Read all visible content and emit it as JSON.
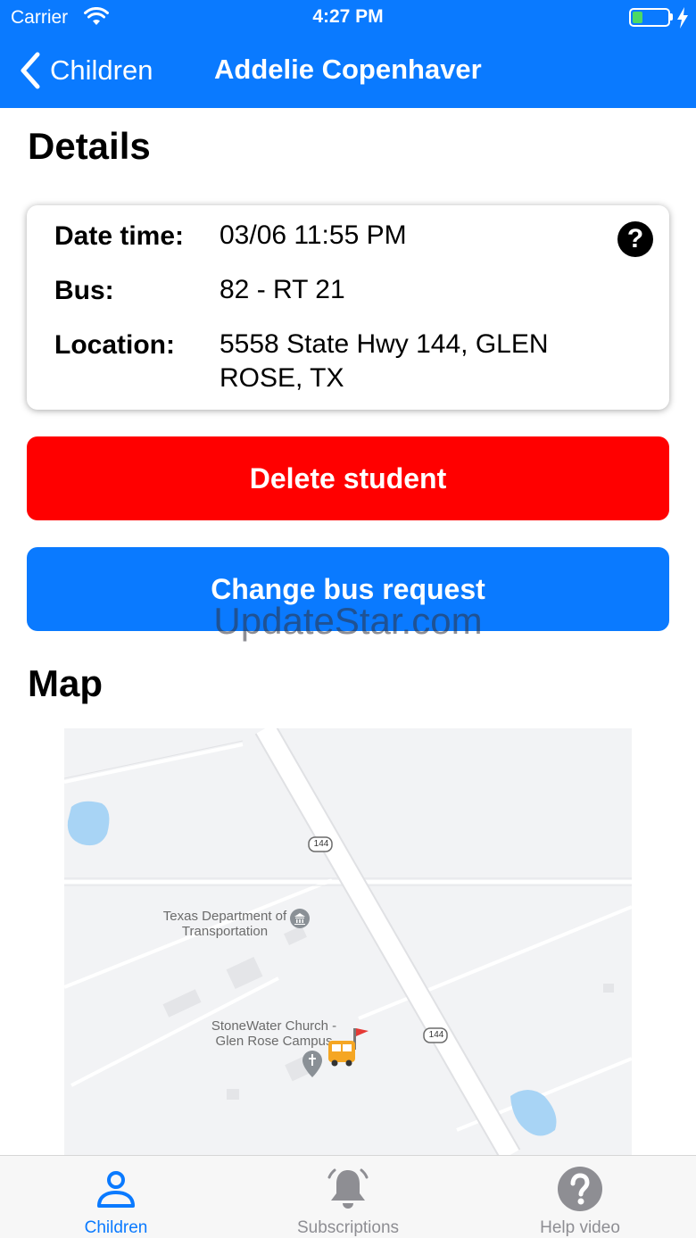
{
  "status_bar": {
    "carrier": "Carrier",
    "time": "4:27 PM",
    "battery_level": 0.3
  },
  "nav": {
    "back_label": "Children",
    "title": "Addelie Copenhaver"
  },
  "details": {
    "section_title": "Details",
    "rows": [
      {
        "label": "Date time:",
        "value": "03/06 11:55 PM"
      },
      {
        "label": "Bus:",
        "value": "82 - RT 21"
      },
      {
        "label": "Location:",
        "value": "5558 State Hwy 144, GLEN ROSE, TX"
      }
    ],
    "help_glyph": "?"
  },
  "actions": {
    "delete_label": "Delete student",
    "change_label": "Change bus request"
  },
  "watermark": "UpdateStar.com",
  "map": {
    "section_title": "Map",
    "labels": {
      "poi_1": "Texas Department of Transportation",
      "poi_2": "StoneWater Church - Glen Rose Campus",
      "road_shield_1": "144",
      "road_shield_2": "144"
    }
  },
  "tabs": [
    {
      "label": "Children",
      "icon": "person-icon",
      "active": true
    },
    {
      "label": "Subscriptions",
      "icon": "bell-icon",
      "active": false
    },
    {
      "label": "Help video",
      "icon": "question-circle-icon",
      "active": false
    }
  ],
  "colors": {
    "brand_blue": "#0a7aff",
    "delete_red": "#ff0000",
    "tab_inactive": "#8e8e93",
    "battery_green": "#4cd964"
  }
}
